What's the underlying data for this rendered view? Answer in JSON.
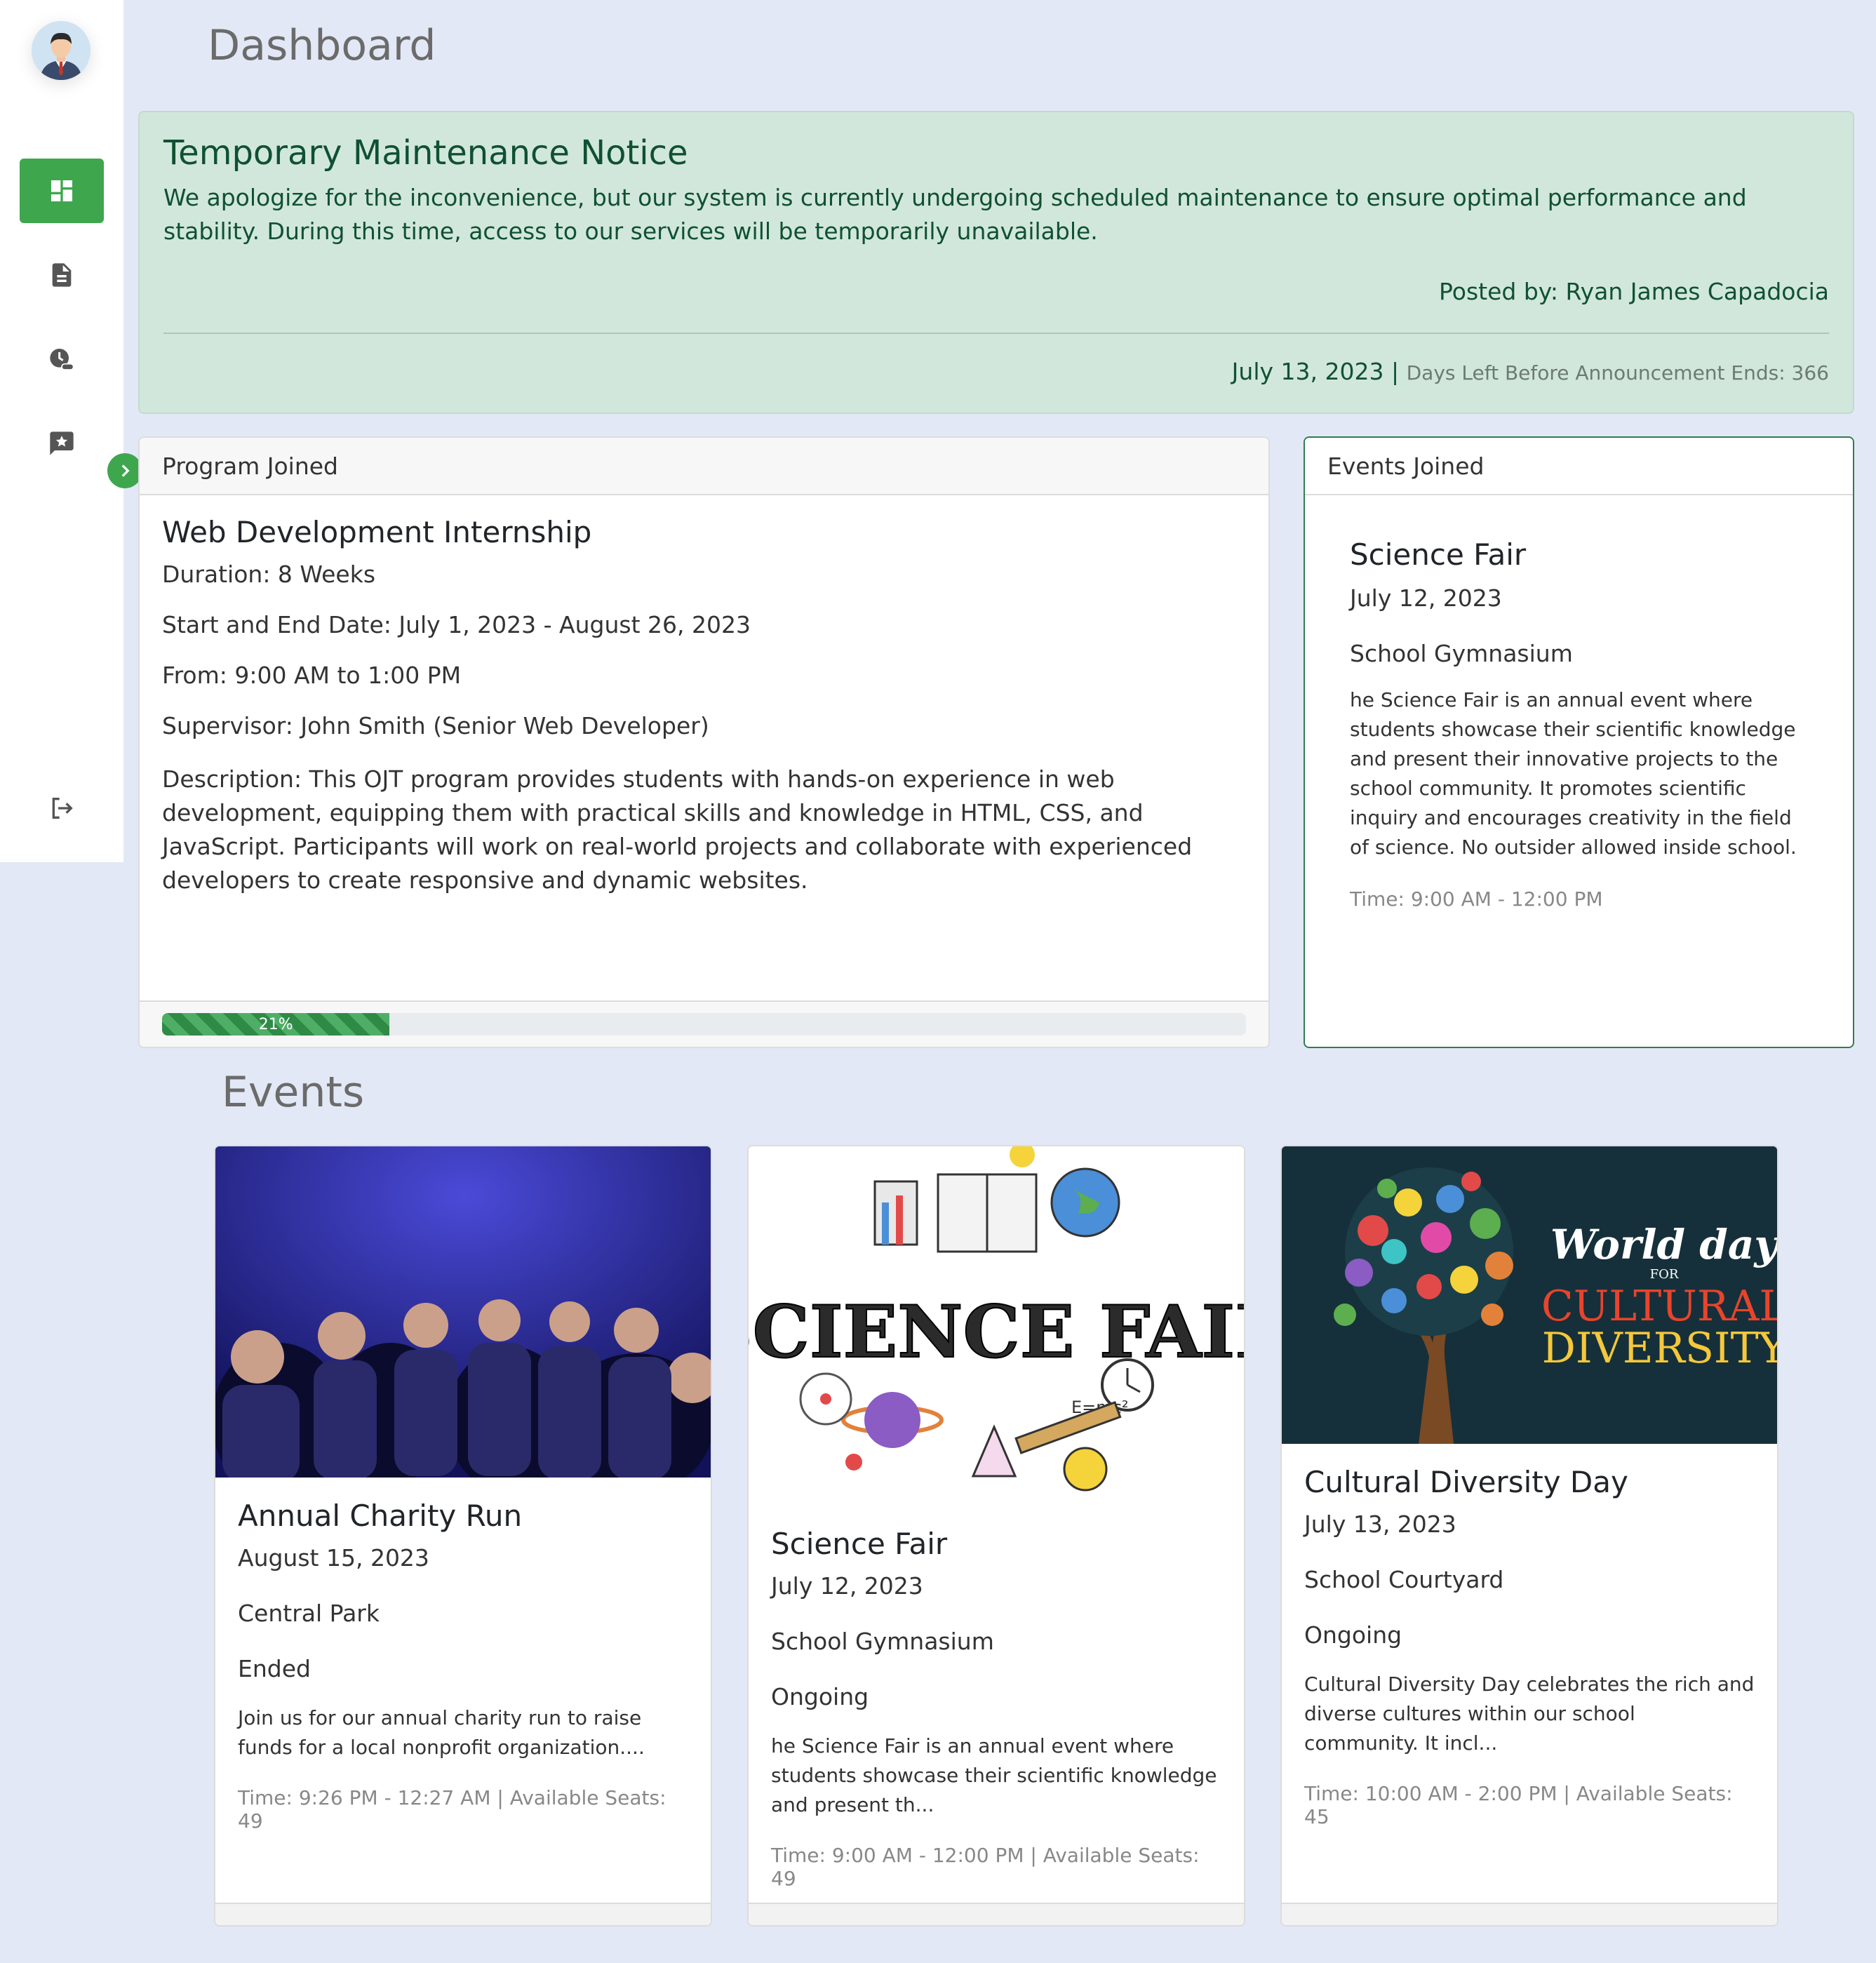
{
  "page": {
    "title": "Dashboard"
  },
  "sidebar": {
    "items": [
      {
        "icon": "dashboard-icon",
        "active": true
      },
      {
        "icon": "document-icon",
        "active": false
      },
      {
        "icon": "history-icon",
        "active": false
      },
      {
        "icon": "feedback-icon",
        "active": false
      }
    ],
    "logout_icon": "logout-icon",
    "toggle_icon": "chevron-right-icon",
    "accent": "#3ea74e"
  },
  "notice": {
    "title": "Temporary Maintenance Notice",
    "body": "We apologize for the inconvenience, but our system is currently undergoing scheduled maintenance to ensure optimal performance and stability. During this time, access to our services will be temporarily unavailable.",
    "author": "Posted by: Ryan James Capadocia",
    "date": "July 13, 2023",
    "separator": "|",
    "days_left": "Days Left Before Announcement Ends: 366"
  },
  "program": {
    "header": "Program Joined",
    "title": "Web Development Internship",
    "duration": "Duration: 8 Weeks",
    "dates": "Start and End Date: July 1, 2023 - August 26, 2023",
    "hours": "From: 9:00 AM to 1:00 PM",
    "supervisor": "Supervisor: John Smith (Senior Web Developer)",
    "description": "Description: This OJT program provides students with hands-on experience in web development, equipping them with practical skills and knowledge in HTML, CSS, and JavaScript. Participants will work on real-world projects and collaborate with experienced developers to create responsive and dynamic websites.",
    "progress_label": "21%",
    "progress_value": 21
  },
  "events_joined": {
    "header": "Events Joined",
    "title": "Science Fair",
    "date": "July 12, 2023",
    "location": "School Gymnasium",
    "description": "he Science Fair is an annual event where students showcase their scientific knowledge and present their innovative projects to the school community. It promotes scientific inquiry and encourages creativity in the field of science. No outsider allowed inside school.",
    "time": "Time: 9:00 AM - 12:00 PM"
  },
  "events": {
    "title": "Events",
    "items": [
      {
        "title": "Annual Charity Run",
        "date": "August 15, 2023",
        "location": "Central Park",
        "status": "Ended",
        "description": "Join us for our annual charity run to raise funds for a local nonprofit organization....",
        "time": "Time: 9:26 PM - 12:27 AM | Available Seats: 49",
        "image": "audience-photo"
      },
      {
        "title": "Science Fair",
        "date": "July 12, 2023",
        "location": "School Gymnasium",
        "status": "Ongoing",
        "description": "he Science Fair is an annual event where students showcase their scientific knowledge and present th...",
        "time": "Time: 9:00 AM - 12:00 PM | Available Seats: 49",
        "image": "science-fair-illustration",
        "image_text": "SCIENCE FAIR"
      },
      {
        "title": "Cultural Diversity Day",
        "date": "July 13, 2023",
        "location": "School Courtyard",
        "status": "Ongoing",
        "description": "Cultural Diversity Day celebrates the rich and diverse cultures within our school community. It incl...",
        "time": "Time: 10:00 AM - 2:00 PM | Available Seats: 45",
        "image": "handprint-tree-poster",
        "image_text": [
          "World day",
          "FOR",
          "CULTURAL",
          "DIVERSITY"
        ]
      }
    ]
  }
}
